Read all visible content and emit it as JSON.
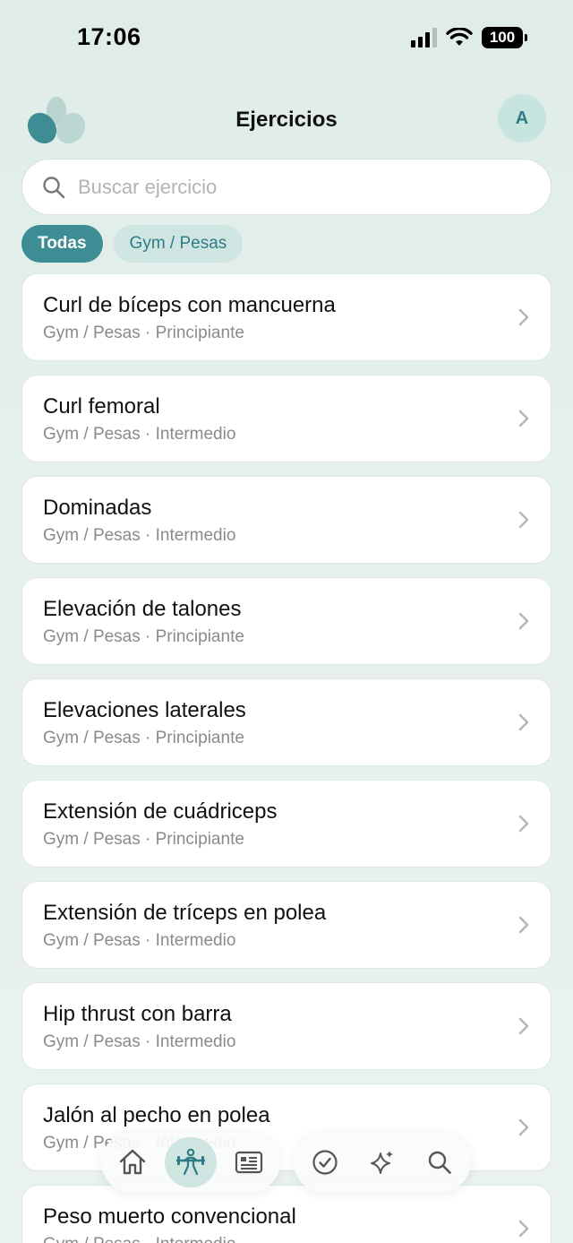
{
  "status_bar": {
    "time": "17:06",
    "battery": "100"
  },
  "header": {
    "title": "Ejercicios",
    "avatar_initial": "A"
  },
  "search": {
    "placeholder": "Buscar ejercicio",
    "value": ""
  },
  "filters": {
    "items": [
      {
        "label": "Todas",
        "active": true
      },
      {
        "label": "Gym / Pesas",
        "active": false
      }
    ]
  },
  "exercises": [
    {
      "name": "Curl de bíceps con mancuerna",
      "meta": "Gym / Pesas · Principiante"
    },
    {
      "name": "Curl femoral",
      "meta": "Gym / Pesas · Intermedio"
    },
    {
      "name": "Dominadas",
      "meta": "Gym / Pesas · Intermedio"
    },
    {
      "name": "Elevación de talones",
      "meta": "Gym / Pesas · Principiante"
    },
    {
      "name": "Elevaciones laterales",
      "meta": "Gym / Pesas · Principiante"
    },
    {
      "name": "Extensión de cuádriceps",
      "meta": "Gym / Pesas · Principiante"
    },
    {
      "name": "Extensión de tríceps en polea",
      "meta": "Gym / Pesas · Intermedio"
    },
    {
      "name": "Hip thrust con barra",
      "meta": "Gym / Pesas · Intermedio"
    },
    {
      "name": "Jalón al pecho en polea",
      "meta": "Gym / Pesas · Intermedio"
    },
    {
      "name": "Peso muerto convencional",
      "meta": "Gym / Pesas · Intermedio"
    }
  ],
  "bottom_nav": {
    "left": [
      {
        "icon": "home-icon",
        "active": false
      },
      {
        "icon": "weightlifter-icon",
        "active": true
      },
      {
        "icon": "news-icon",
        "active": false
      }
    ],
    "right": [
      {
        "icon": "check-circle-icon",
        "active": false
      },
      {
        "icon": "sparkles-icon",
        "active": false
      },
      {
        "icon": "search-icon",
        "active": false
      }
    ]
  },
  "colors": {
    "accent": "#3f8d94",
    "chip_inactive": "#cfe5e1",
    "background": "#e3eee9"
  }
}
